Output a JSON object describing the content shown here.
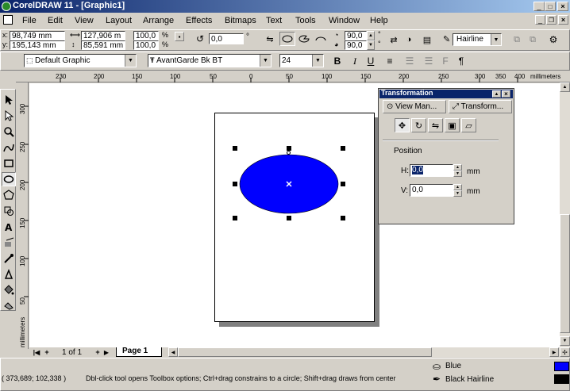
{
  "window": {
    "title": "CorelDRAW 11 - [Graphic1]"
  },
  "menu": [
    "File",
    "Edit",
    "View",
    "Layout",
    "Arrange",
    "Effects",
    "Bitmaps",
    "Text",
    "Tools",
    "Window",
    "Help"
  ],
  "property_bar": {
    "x": "98,749 mm",
    "y": "195,143 mm",
    "width": "127,906 m",
    "height": "85,591 mm",
    "scale_x": "100,0",
    "scale_y": "100,0",
    "percent": "%",
    "rotation": "0,0",
    "degree": "°",
    "angle_start": "90,0",
    "angle_end": "90,0",
    "outline": "Hairline"
  },
  "text_bar": {
    "style": "Default Graphic ",
    "font": "AvantGarde Bk BT",
    "size": "24"
  },
  "ruler": {
    "labels": [
      "230",
      "200",
      "150",
      "100",
      "50",
      "0",
      "50",
      "100",
      "150",
      "200",
      "250",
      "300",
      "350",
      "400"
    ],
    "unit": "millimeters",
    "vlabels": [
      "300",
      "250",
      "200",
      "150",
      "100",
      "50"
    ],
    "vunit": "millimeters"
  },
  "docker": {
    "title": "Transformation",
    "tab_view": "View Man...",
    "tab_transform": "Transform...",
    "section": "Position",
    "h_label": "H:",
    "h_value": "0,0",
    "v_label": "V:",
    "v_value": "0,0",
    "unit": "mm"
  },
  "page_nav": {
    "counter": "1 of 1",
    "tab": "Page 1"
  },
  "status": {
    "coords": "( 373,689; 102,338 )",
    "hint": "Dbl-click tool opens Toolbox options; Ctrl+drag constrains to a circle; Shift+drag draws from center",
    "fill_label": "Blue",
    "outline_label": "Black  Hairline"
  },
  "colors": {
    "fill": "#0000ff",
    "titlebar_start": "#0a246a",
    "titlebar_end": "#a6caf0"
  }
}
